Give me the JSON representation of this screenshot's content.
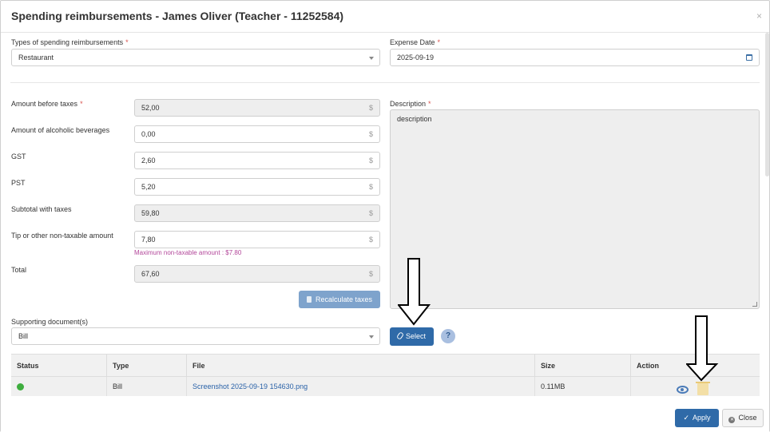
{
  "modal": {
    "title": "Spending reimbursements - James Oliver (Teacher - 11252584)",
    "close_glyph": "×"
  },
  "form": {
    "types_label": "Types of spending reimbursements",
    "types_value": "Restaurant",
    "expense_date_label": "Expense Date",
    "expense_date_value": "2025-09-19",
    "required_mark": "*",
    "amount_before_taxes_label": "Amount before taxes",
    "amount_before_taxes_value": "52,00",
    "alcoholic_label": "Amount of alcoholic beverages",
    "alcoholic_value": "0,00",
    "gst_label": "GST",
    "gst_value": "2,60",
    "pst_label": "PST",
    "pst_value": "5,20",
    "subtotal_label": "Subtotal with taxes",
    "subtotal_value": "59,80",
    "tip_label": "Tip or other non-taxable amount",
    "tip_value": "7,80",
    "tip_hint": "Maximum non-taxable amount : $7.80",
    "total_label": "Total",
    "total_value": "67,60",
    "currency_symbol": "$",
    "description_label": "Description",
    "description_value": "description",
    "recalculate_label": "Recalculate taxes",
    "supporting_label": "Supporting document(s)",
    "supporting_value": "Bill",
    "select_label": "Select",
    "help_label": "?"
  },
  "table": {
    "headers": [
      "Status",
      "Type",
      "File",
      "Size",
      "Action"
    ],
    "rows": [
      {
        "status": "ok",
        "type": "Bill",
        "file": "Screenshot 2025-09-19 154630.png",
        "size": "0.11MB"
      }
    ]
  },
  "footer": {
    "apply_label": "Apply",
    "close_label": "Close"
  },
  "colors": {
    "primary": "#2f6aa8",
    "primary_disabled": "#7ea3cc",
    "required": "#d9534f",
    "hint": "#b3479a",
    "status_ok": "#3fae3f"
  }
}
